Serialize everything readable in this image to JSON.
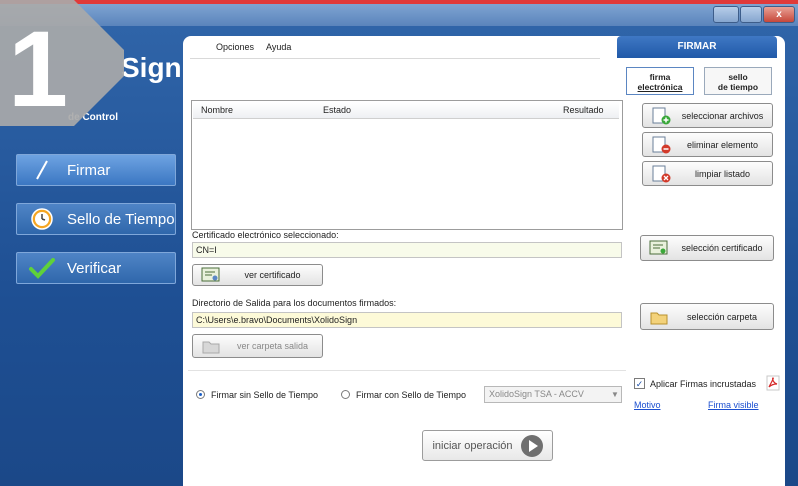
{
  "badge": {
    "number": "1"
  },
  "sidebar": {
    "logo_text": "Sign",
    "panel_label": "de Control",
    "items": [
      {
        "label": "Firmar",
        "icon": "pen-icon"
      },
      {
        "label": "Sello de Tiempo",
        "icon": "clock-icon"
      },
      {
        "label": "Verificar",
        "icon": "checkmark-icon"
      }
    ]
  },
  "window": {
    "close": "x"
  },
  "menu": {
    "items": [
      "Opciones",
      "Ayuda"
    ]
  },
  "main_tab": "FIRMAR",
  "subtabs": [
    {
      "line1": "firma",
      "line2": "electrónica"
    },
    {
      "line1": "sello",
      "line2": "de tiempo"
    }
  ],
  "file_list": {
    "columns": [
      "Nombre",
      "Estado",
      "Resultado"
    ],
    "rows": []
  },
  "actions": {
    "select_files": "seleccionar archivos",
    "remove_item": "eliminar elemento",
    "clear_list": "limpiar listado",
    "select_cert": "selección certificado",
    "select_folder": "selección carpeta"
  },
  "cert": {
    "label": "Certificado electrónico seleccionado:",
    "value": "CN=I",
    "view_button": "ver certificado"
  },
  "output": {
    "label": "Directorio de Salida para los documentos firmados:",
    "value": "C:\\Users\\e.bravo\\Documents\\XolidoSign",
    "view_button": "ver carpeta salida"
  },
  "options": {
    "without_ts": "Firmar sin Sello de Tiempo",
    "with_ts": "Firmar con Sello de Tiempo",
    "tsa_selected": "XolidoSign TSA - ACCV",
    "apply_embedded": "Aplicar Firmas incrustadas",
    "motivo_link": "Motivo",
    "visible_link": "Firma visible"
  },
  "start_button": "iniciar operación",
  "colors": {
    "accent_blue": "#2f64a8",
    "nav_active": "#3b77c2",
    "title_red": "#e03a3a"
  }
}
